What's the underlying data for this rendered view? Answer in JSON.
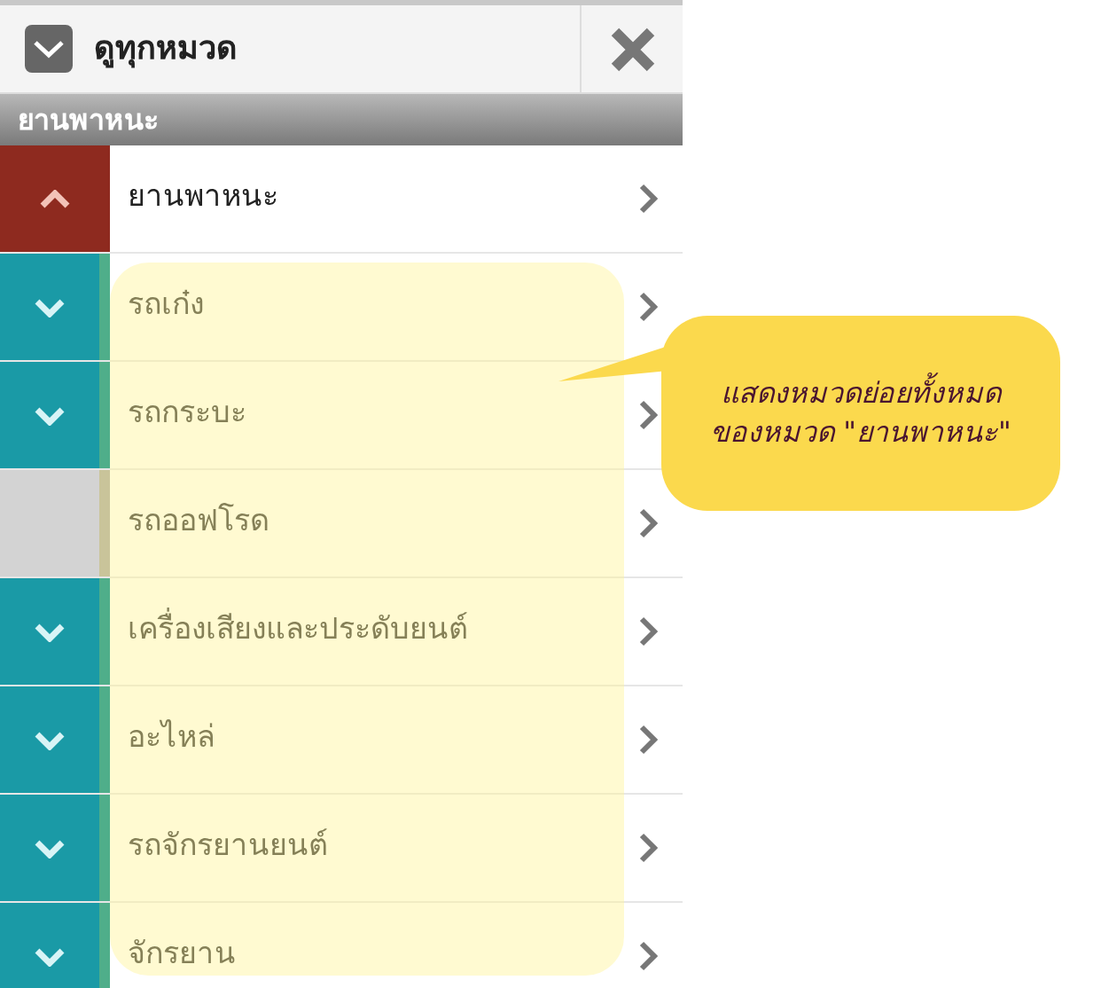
{
  "header": {
    "title": "ดูทุกหมวด"
  },
  "section": {
    "title": "ยานพาหนะ"
  },
  "rows": [
    {
      "kind": "parent",
      "label": "ยานพาหนะ",
      "expanded": true
    },
    {
      "kind": "child",
      "label": "รถเก๋ง",
      "has_children": true
    },
    {
      "kind": "child",
      "label": "รถกระบะ",
      "has_children": true
    },
    {
      "kind": "child",
      "label": "รถออฟโรด",
      "has_children": false
    },
    {
      "kind": "child",
      "label": "เครื่องเสียงและประดับยนต์",
      "has_children": true
    },
    {
      "kind": "child",
      "label": "อะไหล่",
      "has_children": true
    },
    {
      "kind": "child",
      "label": "รถจักรยานยนต์",
      "has_children": true
    },
    {
      "kind": "child",
      "label": "จักรยาน",
      "has_children": true
    }
  ],
  "callout": {
    "lines": [
      "แสดงหมวดย่อยทั้งหมด",
      "ของหมวด \"ยานพาหนะ\""
    ]
  }
}
